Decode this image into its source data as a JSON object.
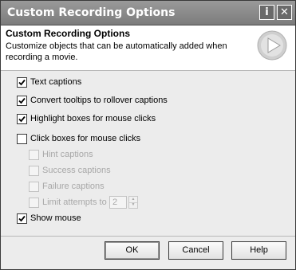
{
  "window": {
    "title": "Custom Recording Options",
    "help_glyph": "i",
    "close_glyph": "✕"
  },
  "header": {
    "title": "Custom Recording Options",
    "description": "Customize objects that can be automatically added when recording a movie."
  },
  "options": {
    "text_captions": {
      "label": "Text captions",
      "checked": true
    },
    "rollover_captions": {
      "label": "Convert tooltips to rollover captions",
      "checked": true
    },
    "highlight_boxes": {
      "label": "Highlight boxes for mouse clicks",
      "checked": true
    },
    "click_boxes": {
      "label": "Click boxes for mouse clicks",
      "checked": false
    },
    "hint_captions": {
      "label": "Hint captions",
      "checked": false,
      "disabled": true
    },
    "success_captions": {
      "label": "Success captions",
      "checked": false,
      "disabled": true
    },
    "failure_captions": {
      "label": "Failure captions",
      "checked": false,
      "disabled": true
    },
    "limit_attempts": {
      "label": "Limit attempts to",
      "checked": false,
      "disabled": true,
      "value": "2"
    },
    "show_mouse": {
      "label": "Show mouse",
      "checked": true
    }
  },
  "buttons": {
    "ok": "OK",
    "cancel": "Cancel",
    "help": "Help"
  }
}
